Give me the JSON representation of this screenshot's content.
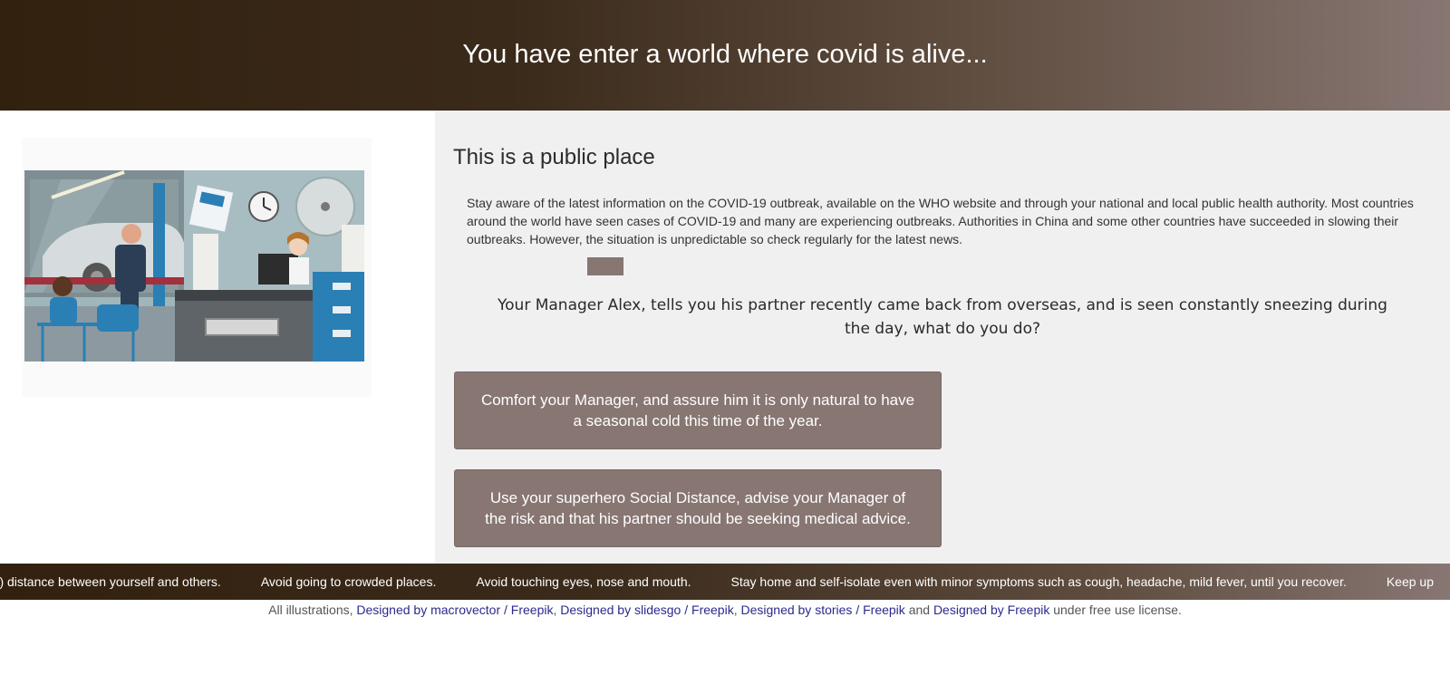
{
  "header": {
    "title": "You have enter a world where covid is alive..."
  },
  "illustration": {
    "icon": "office-waiting-room-illustration"
  },
  "main": {
    "section_title": "This is a public place",
    "info_text": "Stay aware of the latest information on the COVID-19 outbreak, available on the WHO website and through your national and local public health authority. Most countries around the world have seen cases of COVID-19 and many are experiencing outbreaks. Authorities in China and some other countries have succeeded in slowing their outbreaks. However, the situation is unpredictable so check regularly for the latest news.",
    "question": "Your Manager Alex, tells you his partner recently came back from overseas, and is seen constantly sneezing during the day, what do you do?",
    "choices": [
      "Comfort your Manager, and assure him it is only natural to have a seasonal cold this time of the year.",
      "Use your superhero Social Distance, advise your Manager of the risk and that his partner should be seeking medical advice."
    ]
  },
  "ticker": {
    "items": [
      "eet) distance between yourself and others.",
      "Avoid going to crowded places.",
      "Avoid touching eyes, nose and mouth.",
      "Stay home and self-isolate even with minor symptoms such as cough, headache, mild fever, until you recover.",
      "Keep up"
    ]
  },
  "footer": {
    "prefix": "All illustrations,",
    "link1": "Designed by macrovector / Freepik",
    "sep1": ",",
    "link2": "Designed by slidesgo / Freepik",
    "sep2": ",",
    "link3": "Designed by stories / Freepik",
    "and": "and",
    "link4": "Designed by Freepik",
    "suffix": "under free use license."
  },
  "colors": {
    "header_dark": "#33210f",
    "header_light": "#877672",
    "button_bg": "#877672",
    "panel_bg": "#f0f0f0",
    "link": "#2c2a8c"
  }
}
